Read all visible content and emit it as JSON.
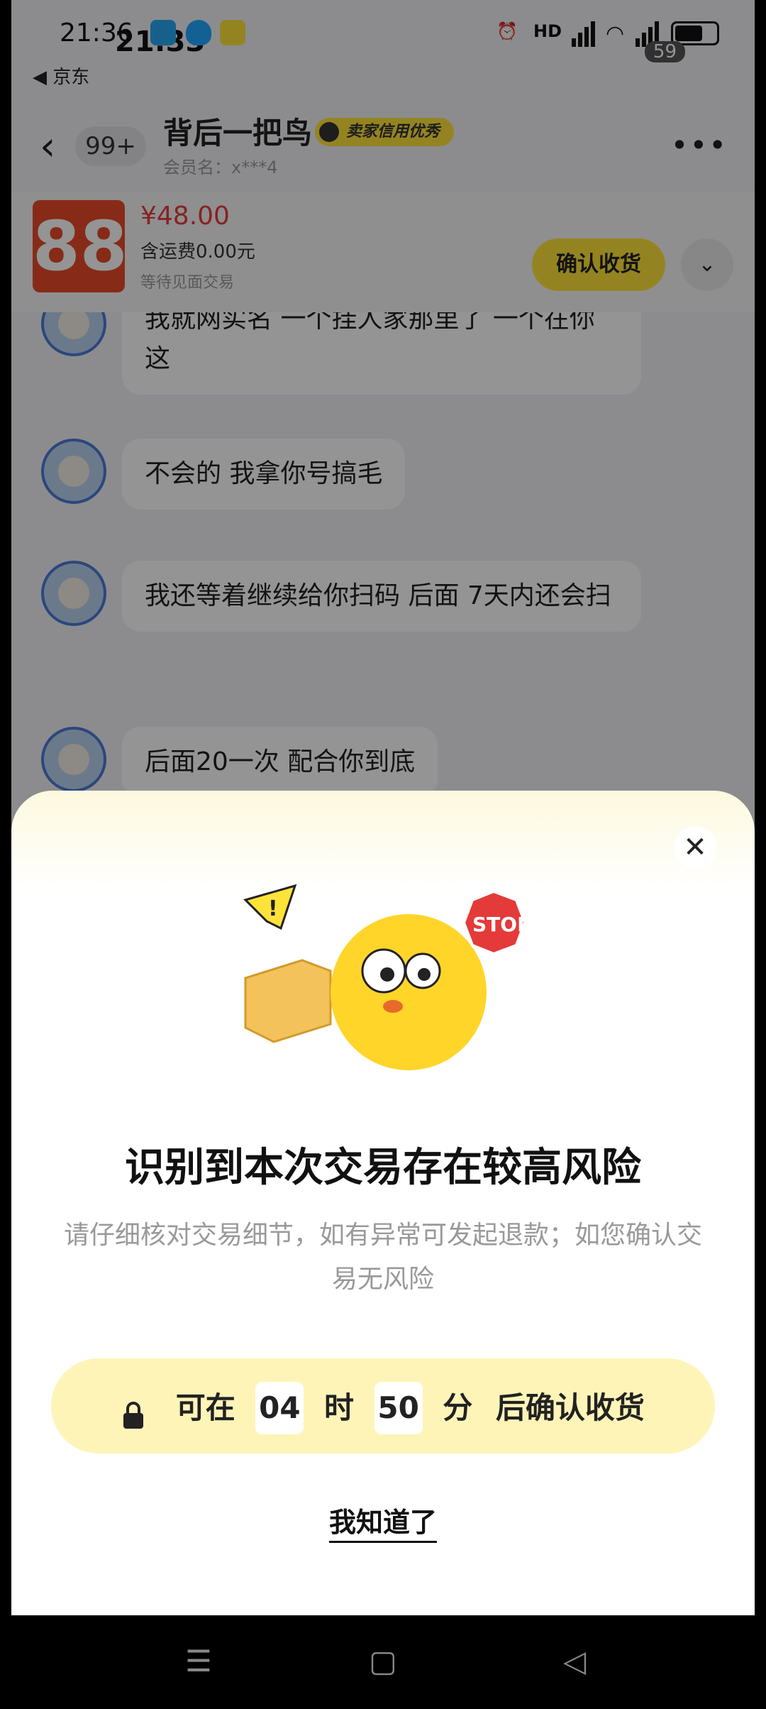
{
  "status_bar": {
    "time": "21:36",
    "time_overlay": "21:33",
    "back_app": "◀ 京东",
    "battery_percent": "59"
  },
  "header": {
    "unread_count": "99+",
    "seller_name": "背后一把鸟",
    "seller_badge": "卖家信用优秀",
    "member_label": "会员名：x***4"
  },
  "product": {
    "price": "¥48.00",
    "shipping": "含运费0.00元",
    "status": "等待见面交易",
    "confirm_button": "确认收货"
  },
  "chat": {
    "messages": [
      "我就网实名 一个挂人家那里了 一个在你这",
      "不会的 我拿你号搞毛",
      "我还等着继续给你扫码 后面 7天内还会扫",
      "后面20一次 配合你到底"
    ]
  },
  "risk_sheet": {
    "title": "识别到本次交易存在较高风险",
    "description": "请仔细核对交易细节，如有异常可发起退款；如您确认交易无风险",
    "countdown": {
      "prefix": "可在",
      "hours": "04",
      "hours_unit": "时",
      "minutes": "50",
      "minutes_unit": "分",
      "suffix": "后确认收货"
    },
    "ok_link": "我知道了",
    "illustration_sign": "STOP",
    "illustration_alert": "!"
  },
  "colors": {
    "brand_yellow": "#ffe33a",
    "price_red": "#e83b3b",
    "countdown_bg": "#fff4b8"
  }
}
